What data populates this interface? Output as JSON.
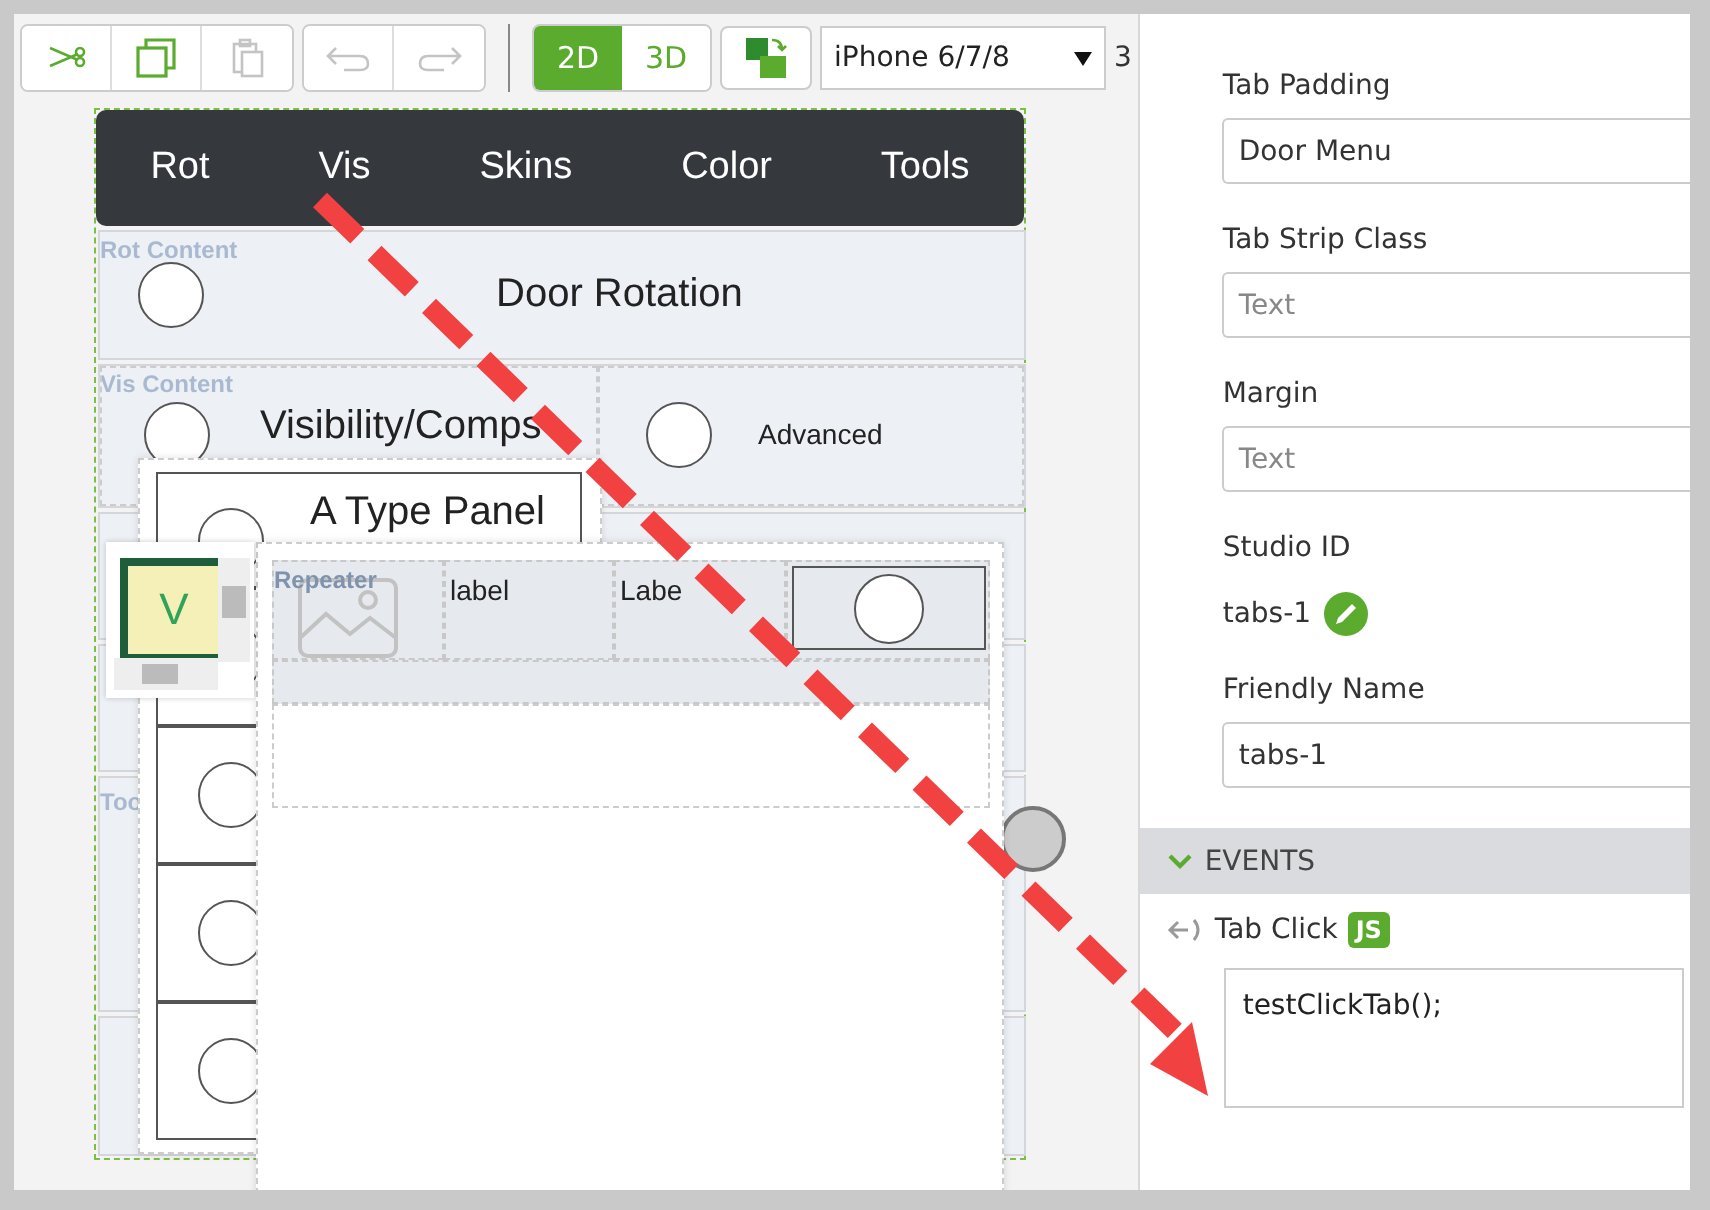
{
  "toolbar": {
    "edit_tools": [
      {
        "kind": "cut",
        "disabled": false
      },
      {
        "kind": "copy",
        "disabled": false
      },
      {
        "kind": "paste",
        "disabled": true
      }
    ],
    "history": [
      {
        "kind": "undo",
        "disabled": true
      },
      {
        "kind": "redo",
        "disabled": true
      }
    ],
    "view_modes": [
      {
        "label": "2D",
        "selected": true
      },
      {
        "label": "3D",
        "selected": false
      }
    ],
    "device_select": {
      "value": "iPhone 6/7/8"
    },
    "trailing_text": "3"
  },
  "canvas": {
    "tabs": [
      "Rot",
      "Vis",
      "Skins",
      "Color",
      "Tools"
    ],
    "rot_section": {
      "label": "Rot Content",
      "title": "Door Rotation"
    },
    "vis_section": {
      "label": "Vis Content",
      "cells": [
        "Visibility/Comps",
        "Advanced"
      ]
    },
    "tools_label": "Too",
    "type_panel": {
      "title": "A Type Panel"
    },
    "repeater": {
      "label": "Repeater",
      "cells": [
        "label",
        "Labe"
      ]
    },
    "thumbnail": {
      "letter": "V"
    }
  },
  "properties": {
    "fields": [
      {
        "kind": "input",
        "label": "Tab Padding",
        "value": "Door Menu"
      },
      {
        "kind": "input",
        "label": "Tab Strip Class",
        "placeholder": "Text"
      },
      {
        "kind": "input",
        "label": "Margin",
        "placeholder": "Text"
      },
      {
        "kind": "id",
        "label": "Studio ID",
        "value": "tabs-1"
      },
      {
        "kind": "input",
        "label": "Friendly Name",
        "value": "tabs-1"
      }
    ],
    "events": {
      "title": "EVENTS",
      "expanded": true,
      "items": [
        {
          "name": "Tab Click",
          "badge": "JS",
          "code": "testClickTab();"
        }
      ]
    }
  }
}
